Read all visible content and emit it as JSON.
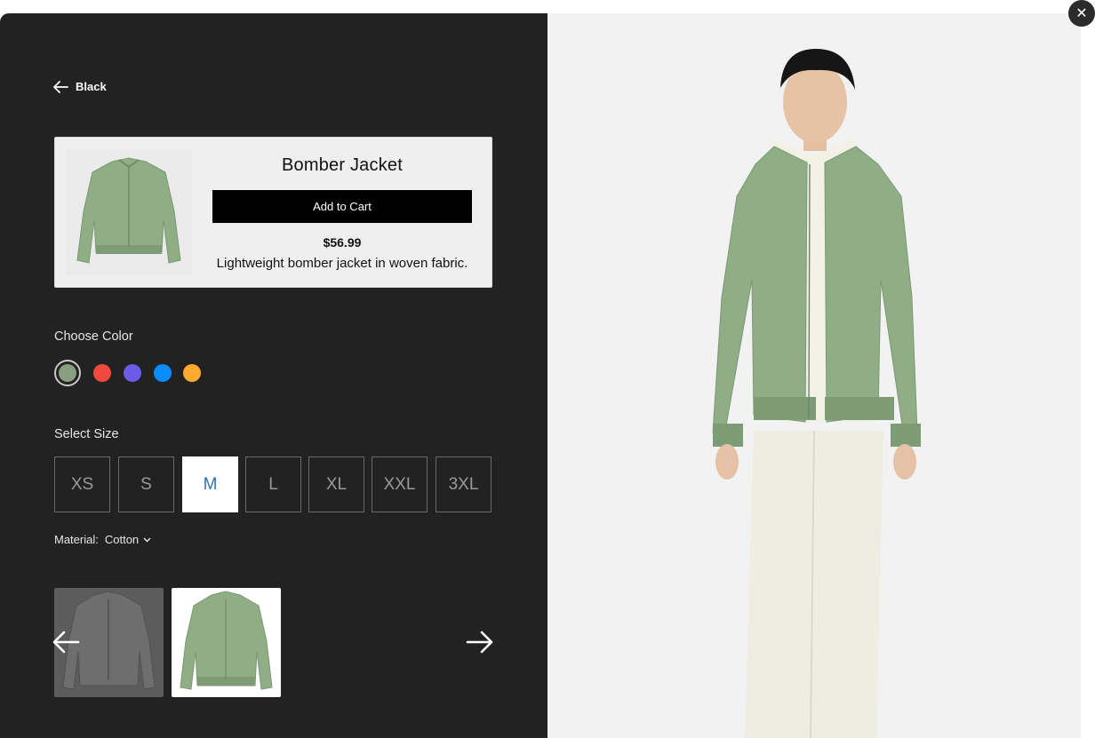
{
  "window": {
    "close_label": "✕"
  },
  "back": {
    "label": "Black"
  },
  "product": {
    "title": "Bomber Jacket",
    "add_to_cart_label": "Add to Cart",
    "price": "$56.99",
    "description": "Lightweight bomber jacket in woven fabric."
  },
  "color": {
    "label": "Choose Color",
    "swatches": [
      "#8a9e82",
      "#f04a3f",
      "#6b5be6",
      "#0a8cff",
      "#ffab2d"
    ],
    "selected_index": 0
  },
  "size": {
    "label": "Select Size",
    "options": [
      "XS",
      "S",
      "M",
      "L",
      "XL",
      "XXL",
      "3XL"
    ],
    "selected": "M"
  },
  "material": {
    "label": "Material:",
    "value": "Cotton"
  },
  "gallery": {
    "prev_icon": "arrow-left-icon",
    "next_icon": "arrow-right-icon"
  },
  "colors": {
    "panel_bg": "#222222",
    "jacket_green": "#8fae86",
    "accent_blue": "#2f6fbf"
  }
}
